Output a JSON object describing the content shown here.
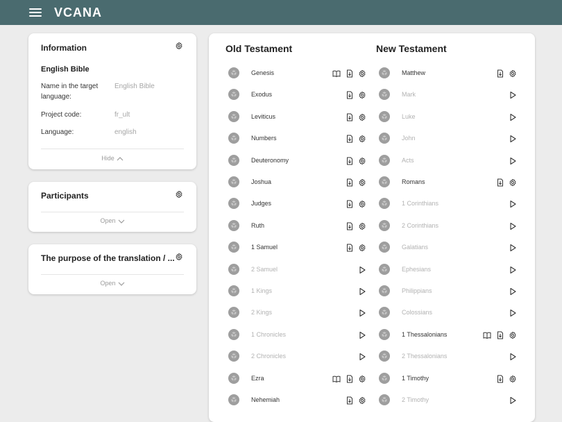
{
  "app": {
    "logo": "VCANA"
  },
  "information": {
    "title": "Information",
    "heading": "English Bible",
    "fields": [
      {
        "label": "Name in the target language:",
        "value": "English Bible"
      },
      {
        "label": "Project code:",
        "value": "fr_ult"
      },
      {
        "label": "Language:",
        "value": "english"
      }
    ],
    "toggle": "Hide"
  },
  "participants": {
    "title": "Participants",
    "toggle": "Open"
  },
  "purpose": {
    "title": "The purpose of the translation / ...",
    "toggle": "Open"
  },
  "old_testament": {
    "title": "Old Testament",
    "books": [
      {
        "name": "Genesis",
        "active": true,
        "bible": true
      },
      {
        "name": "Exodus",
        "active": true
      },
      {
        "name": "Leviticus",
        "active": true
      },
      {
        "name": "Numbers",
        "active": true
      },
      {
        "name": "Deuteronomy",
        "active": true
      },
      {
        "name": "Joshua",
        "active": true
      },
      {
        "name": "Judges",
        "active": true
      },
      {
        "name": "Ruth",
        "active": true
      },
      {
        "name": "1 Samuel",
        "active": true
      },
      {
        "name": "2 Samuel",
        "active": false
      },
      {
        "name": "1 Kings",
        "active": false
      },
      {
        "name": "2 Kings",
        "active": false
      },
      {
        "name": "1 Chronicles",
        "active": false
      },
      {
        "name": "2 Chronicles",
        "active": false
      },
      {
        "name": "Ezra",
        "active": true,
        "bible": true
      },
      {
        "name": "Nehemiah",
        "active": true
      }
    ]
  },
  "new_testament": {
    "title": "New Testament",
    "books": [
      {
        "name": "Matthew",
        "active": true
      },
      {
        "name": "Mark",
        "active": false
      },
      {
        "name": "Luke",
        "active": false
      },
      {
        "name": "John",
        "active": false
      },
      {
        "name": "Acts",
        "active": false
      },
      {
        "name": "Romans",
        "active": true
      },
      {
        "name": "1 Corinthians",
        "active": false
      },
      {
        "name": "2 Corinthians",
        "active": false
      },
      {
        "name": "Galatians",
        "active": false
      },
      {
        "name": "Ephesians",
        "active": false
      },
      {
        "name": "Philippians",
        "active": false
      },
      {
        "name": "Colossians",
        "active": false
      },
      {
        "name": "1 Thessalonians",
        "active": true,
        "bible": true
      },
      {
        "name": "2 Thessalonians",
        "active": false
      },
      {
        "name": "1 Timothy",
        "active": true
      },
      {
        "name": "2 Timothy",
        "active": false
      }
    ]
  },
  "colors": {
    "topbar": "#4a6b6f",
    "book_icon": "#9e9e9e",
    "muted_text": "#b2b2b2"
  }
}
